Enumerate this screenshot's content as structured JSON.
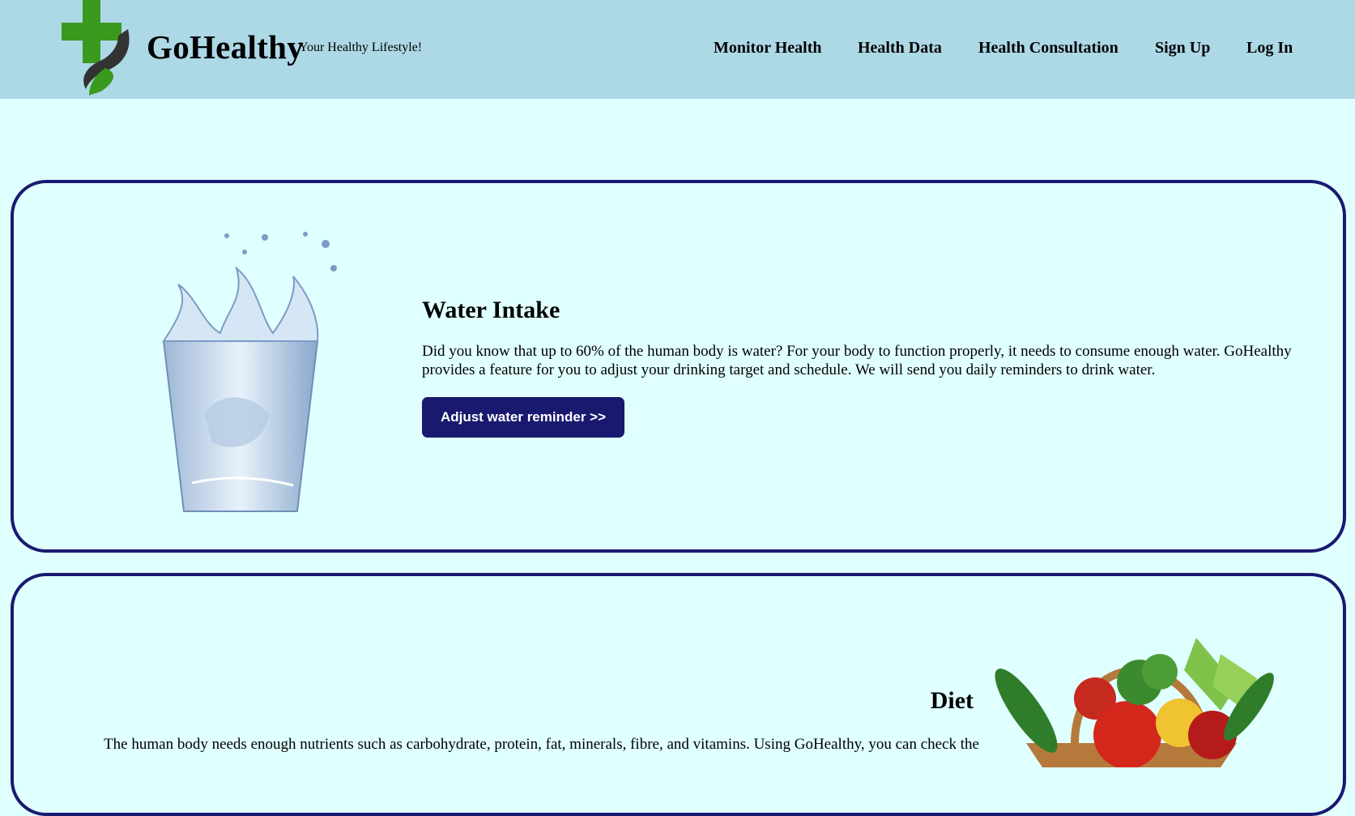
{
  "header": {
    "brand": "GoHealthy",
    "tagline": "Your Healthy Lifestyle!",
    "logo_icon": "medical-cross-leaf-icon"
  },
  "nav": {
    "items": [
      {
        "label": "Monitor Health"
      },
      {
        "label": "Health Data"
      },
      {
        "label": "Health Consultation"
      },
      {
        "label": "Sign Up"
      },
      {
        "label": "Log In"
      }
    ]
  },
  "water": {
    "title": "Water Intake",
    "description": "Did you know that up to 60% of the human body is water? For your body to function properly, it needs to consume enough water. GoHealthy provides a feature for you to adjust your drinking target and schedule. We will send you daily reminders to drink water.",
    "button_label": "Adjust water reminder >>",
    "image_icon": "water-glass-splash-icon"
  },
  "diet": {
    "title": "Diet",
    "description": "The human body needs enough nutrients such as carbohydrate, protein, fat, minerals, fibre, and vitamins. Using GoHealthy, you can check the",
    "image_icon": "vegetable-basket-icon"
  },
  "colors": {
    "header_bg": "#add8e6",
    "page_bg": "#e0ffff",
    "accent": "#191970",
    "logo_green": "#3a9a1e"
  }
}
